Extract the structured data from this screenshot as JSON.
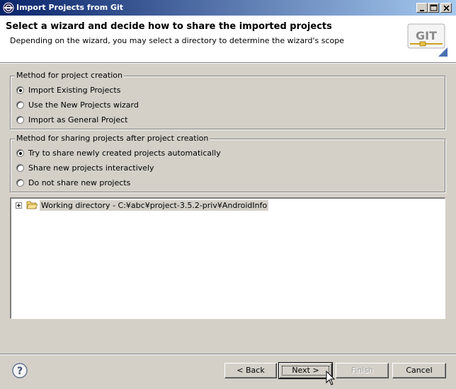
{
  "window": {
    "title": "Import Projects from Git",
    "controls": [
      "minimize",
      "maximize",
      "close"
    ]
  },
  "banner": {
    "title": "Select a wizard and decide how to share the imported projects",
    "description": "Depending on the wizard, you may select a directory to determine the wizard's scope",
    "logo_text": "GIT"
  },
  "creation_group": {
    "legend": "Method for project creation",
    "options": [
      {
        "label": "Import Existing Projects",
        "selected": true
      },
      {
        "label": "Use the New Projects wizard",
        "selected": false
      },
      {
        "label": "Import as General Project",
        "selected": false
      }
    ]
  },
  "sharing_group": {
    "legend": "Method for sharing projects after project creation",
    "options": [
      {
        "label": "Try to share newly created projects automatically",
        "selected": true
      },
      {
        "label": "Share new projects interactively",
        "selected": false
      },
      {
        "label": "Do not share new projects",
        "selected": false
      }
    ]
  },
  "tree": {
    "items": [
      {
        "label": "Working directory - C:¥abc¥project-3.5.2-priv¥AndroidInfo",
        "icon": "folder-open-icon",
        "expanded": false
      }
    ]
  },
  "footer": {
    "back_label": "< Back",
    "next_label": "Next >",
    "finish_label": "Finish",
    "cancel_label": "Cancel"
  }
}
